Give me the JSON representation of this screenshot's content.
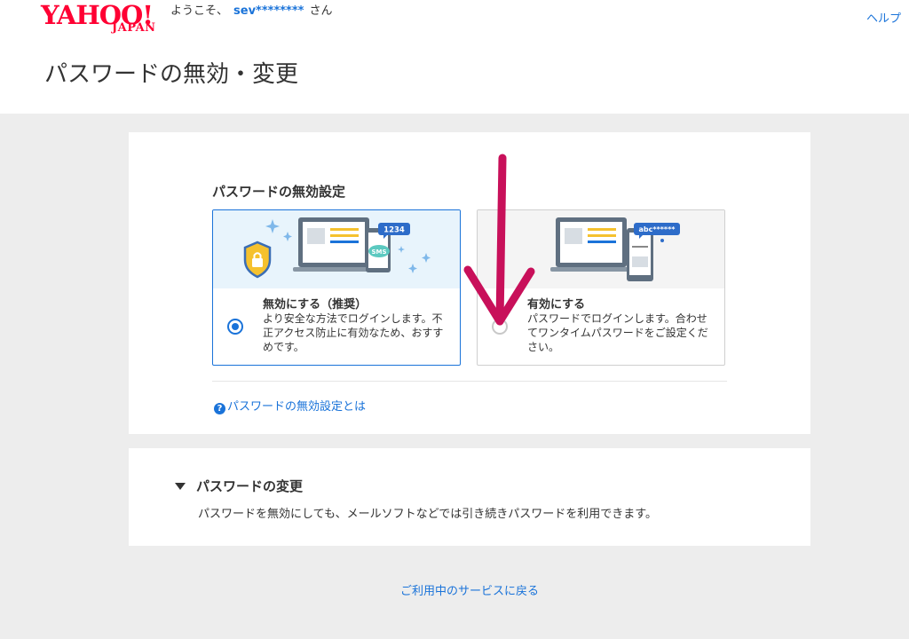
{
  "header": {
    "logo_main": "YAHOO!",
    "logo_sub": "JAPAN",
    "welcome_prefix": "ようこそ、",
    "username": "sev********",
    "welcome_suffix": "さん",
    "help_label": "ヘルプ"
  },
  "page_title": "パスワードの無効・変更",
  "disable_section": {
    "title": "パスワードの無効設定",
    "options": [
      {
        "label": "無効にする（推奨）",
        "description": "より安全な方法でログインします。不正アクセス防止に有効なため、おすすめです。",
        "selected": true,
        "illustration": {
          "badge_text": "1234",
          "bubble_text": "SMS",
          "icons": [
            "shield-lock-icon",
            "laptop-icon",
            "smartphone-icon",
            "sparkle-icon"
          ]
        }
      },
      {
        "label": "有効にする",
        "description": "パスワードでログインします。合わせてワンタイムパスワードをご設定ください。",
        "selected": false,
        "illustration": {
          "badge_text": "abc******",
          "icons": [
            "laptop-icon",
            "smartphone-icon"
          ]
        }
      }
    ],
    "about_link": "パスワードの無効設定とは",
    "about_icon": "?"
  },
  "change_section": {
    "title": "パスワードの変更",
    "description": "パスワードを無効にしても、メールソフトなどでは引き続きパスワードを利用できます。"
  },
  "return_link": "ご利用中のサービスに戻る",
  "colors": {
    "brand": "#ff0033",
    "link": "#1a73d9",
    "annotation_arrow": "#c8105a",
    "page_bg": "#ededed"
  }
}
